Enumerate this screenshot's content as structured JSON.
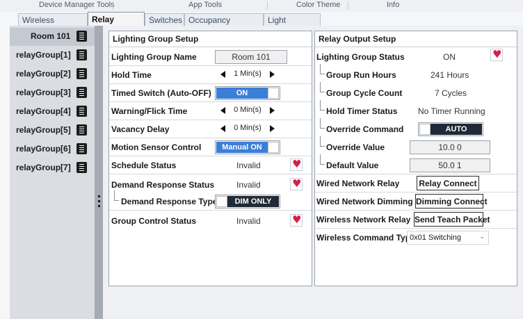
{
  "menu": [
    "Device Manager Tools",
    "App Tools",
    "Color Theme",
    "Info"
  ],
  "tabs": [
    "Wireless Devices",
    "Relay Groups",
    "Switches",
    "Occupancy Sensors",
    "Light Sensors"
  ],
  "sidebar": {
    "items": [
      "Room 101",
      "relayGroup[1]",
      "relayGroup[2]",
      "relayGroup[3]",
      "relayGroup[4]",
      "relayGroup[5]",
      "relayGroup[6]",
      "relayGroup[7]"
    ]
  },
  "setup": {
    "title": "Lighting Group Setup",
    "name_label": "Lighting Group Name",
    "name_value": "Room 101",
    "hold_label": "Hold Time",
    "hold_value": "1 Min(s)",
    "timed_label": "Timed Switch (Auto-OFF)",
    "timed_value": "ON",
    "warning_label": "Warning/Flick Time",
    "warning_value": "0 Min(s)",
    "vacancy_label": "Vacancy Delay",
    "vacancy_value": "0 Min(s)",
    "motion_label": "Motion Sensor Control",
    "motion_value": "Manual ON",
    "schedule_label": "Schedule Status",
    "schedule_value": "Invalid",
    "demand_label": "Demand Response Status",
    "demand_value": "Invalid",
    "demand_type_label": "Demand Response Type",
    "demand_type_value": "DIM ONLY",
    "control_label": "Group Control Status",
    "control_value": "Invalid"
  },
  "output": {
    "title": "Relay Output Setup",
    "status_label": "Lighting Group Status",
    "status_value": "ON",
    "run_hours_label": "Group Run Hours",
    "run_hours_value": "241 Hours",
    "cycle_label": "Group Cycle Count",
    "cycle_value": "7 Cycles",
    "hold_timer_label": "Hold Timer Status",
    "hold_timer_value": "No Timer Running",
    "override_cmd_label": "Override Command",
    "override_cmd_value": "AUTO",
    "override_val_label": "Override Value",
    "override_val_value": "10.0 0",
    "default_val_label": "Default Value",
    "default_val_value": "50.0 1",
    "wired_relay_label": "Wired Network Relay",
    "wired_relay_button": "Relay Connect",
    "wired_dim_label": "Wired Network Dimming",
    "wired_dim_button": "Dimming Connect",
    "wireless_relay_label": "Wireless Network Relay",
    "wireless_relay_button": "Send Teach Packet",
    "wireless_cmd_label": "Wireless Command Type",
    "wireless_cmd_value": "0x01 Switching"
  },
  "colors": {
    "toggle_blue": "#3b7fd8",
    "toggle_dark": "#202a36",
    "heart_red": "#d4204a"
  },
  "icons": [
    "list-icon",
    "status-heart-icon",
    "arrow-left-icon",
    "arrow-right-icon",
    "chevron-down-icon"
  ]
}
